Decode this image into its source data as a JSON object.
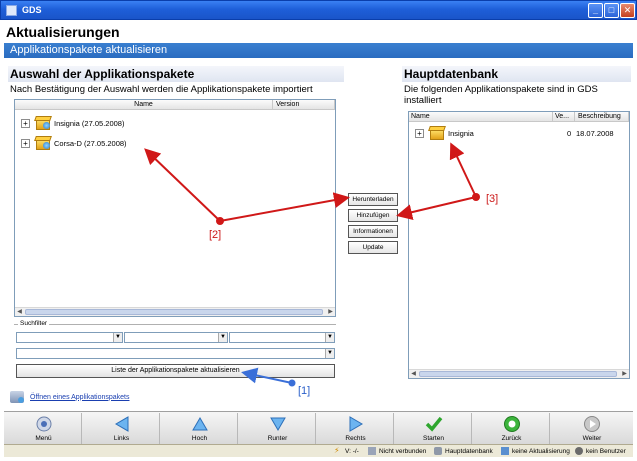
{
  "window": {
    "title": "GDS",
    "controls": [
      "_",
      "□",
      "✕"
    ]
  },
  "header": {
    "title": "Aktualisierungen",
    "subtitle": "Applikationspakete aktualisieren"
  },
  "left_pane": {
    "title": "Auswahl der Applikationspakete",
    "description": "Nach Bestätigung der Auswahl werden die Applikationspakete importiert",
    "columns": [
      "Name",
      "Version"
    ],
    "items": [
      {
        "label": "Insignia (27.05.2008)"
      },
      {
        "label": "Corsa-D (27.05.2008)"
      }
    ]
  },
  "right_pane": {
    "title": "Hauptdatenbank",
    "description_line1": "Die folgenden Applikationspakete sind in GDS",
    "description_line2": "installiert",
    "columns": [
      "Name",
      "Ve...",
      "Beschreibung"
    ],
    "items": [
      {
        "label": "Insignia",
        "version": "0",
        "description": "18.07.2008"
      }
    ]
  },
  "middle_buttons": {
    "download": "Herunterladen",
    "add": "Hinzufügen",
    "info": "Informationen",
    "update": "Update"
  },
  "filter": {
    "label": "Suchfilter"
  },
  "refresh_button": "Liste der Applikationspakete aktualisieren",
  "open_link": "Öffnen eines Applikationspakets",
  "toolbar": {
    "menu": "Menü",
    "left": "Links",
    "up": "Hoch",
    "down": "Runter",
    "right": "Rechts",
    "start": "Starten",
    "back": "Zurück",
    "next": "Weiter"
  },
  "status": {
    "version": "V: -/-",
    "connection": "Nicht verbunden",
    "database": "Hauptdatenbank",
    "update": "keine Aktualisierung",
    "user": "kein Benutzer"
  },
  "annotations": {
    "a1": "[1]",
    "a2": "[2]",
    "a3": "[3]"
  },
  "colors": {
    "arrow_red": "#d01818",
    "arrow_blue": "#3a6fd8",
    "titlebar": "#1e5fd9",
    "link": "#1a3fb0"
  }
}
